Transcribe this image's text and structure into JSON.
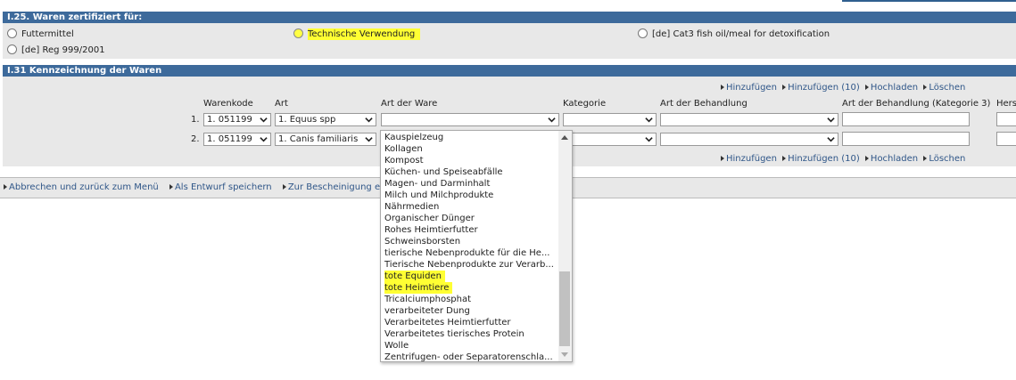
{
  "section_i25": {
    "title": "I.25. Waren zertifiziert für:",
    "options": [
      {
        "label": "Futtermittel",
        "selected": false
      },
      {
        "label": "Technische Verwendung",
        "selected": true
      },
      {
        "label": "[de] Cat3 fish oil/meal for detoxification",
        "selected": false
      },
      {
        "label": "[de] Reg 999/2001",
        "selected": false
      }
    ]
  },
  "section_i31": {
    "title": "I.31 Kennzeichnung der Waren",
    "actions": [
      "Hinzufügen",
      "Hinzufügen (10)",
      "Hochladen",
      "Löschen"
    ],
    "columns": [
      "Warenkode",
      "Art",
      "Art der Ware",
      "Kategorie",
      "Art der Behandlung",
      "Art der Behandlung (Kategorie 3)",
      "Hers"
    ],
    "rows": [
      {
        "num": "1.",
        "warenkode": "1. 051199",
        "art": "1. Equus spp",
        "art_der_ware": "",
        "kategorie": "",
        "behandlung": ""
      },
      {
        "num": "2.",
        "warenkode": "1. 051199",
        "art": "1. Canis familiaris",
        "art_der_ware": "",
        "kategorie": "",
        "behandlung": ""
      }
    ]
  },
  "footer": {
    "links": [
      "Abbrechen und zurück zum Menü",
      "Als Entwurf speichern",
      "Zur Bescheinigung ei"
    ]
  },
  "dropdown": {
    "options": [
      {
        "label": "Kauspielzeug",
        "highlighted": false
      },
      {
        "label": "Kollagen",
        "highlighted": false
      },
      {
        "label": "Kompost",
        "highlighted": false
      },
      {
        "label": "Küchen- und Speiseabfälle",
        "highlighted": false
      },
      {
        "label": "Magen- und Darminhalt",
        "highlighted": false
      },
      {
        "label": "Milch und Milchprodukte",
        "highlighted": false
      },
      {
        "label": "Nährmedien",
        "highlighted": false
      },
      {
        "label": "Organischer Dünger",
        "highlighted": false
      },
      {
        "label": "Rohes Heimtierfutter",
        "highlighted": false
      },
      {
        "label": "Schweinsborsten",
        "highlighted": false
      },
      {
        "label": "tierische Nebenprodukte für die He...",
        "highlighted": false
      },
      {
        "label": "Tierische Nebenprodukte zur Verarb...",
        "highlighted": false
      },
      {
        "label": "tote Equiden",
        "highlighted": true
      },
      {
        "label": "tote Heimtiere",
        "highlighted": true
      },
      {
        "label": "Tricalciumphosphat",
        "highlighted": false
      },
      {
        "label": "verarbeiteter Dung",
        "highlighted": false
      },
      {
        "label": "Verarbeitetes Heimtierfutter",
        "highlighted": false
      },
      {
        "label": "Verarbeitetes tierisches Protein",
        "highlighted": false
      },
      {
        "label": "Wolle",
        "highlighted": false
      },
      {
        "label": "Zentrifugen- oder Separatorenschla...",
        "highlighted": false
      }
    ]
  },
  "colors": {
    "header_bg": "#3d6a9b",
    "highlight": "#ffff33",
    "body_bg": "#e8e8e8",
    "link": "#2f5688"
  }
}
